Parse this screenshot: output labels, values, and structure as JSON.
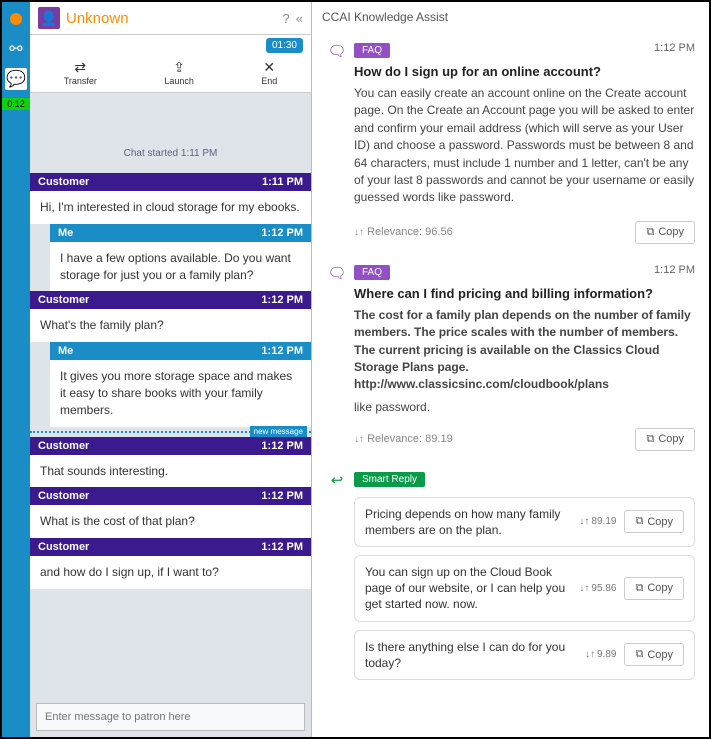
{
  "sidebar": {
    "badge": "0:12"
  },
  "header": {
    "name": "Unknown",
    "timer": "01:30"
  },
  "actions": {
    "transfer": "Transfer",
    "launch": "Launch",
    "end": "End"
  },
  "chat": {
    "started": "Chat started 1:11 PM",
    "labels": {
      "customer": "Customer",
      "me": "Me",
      "newmsg": "new message",
      "placeholder": "Enter message to patron here"
    },
    "m": [
      {
        "who": "customer",
        "time": "1:11 PM",
        "text": "Hi, I'm interested in cloud storage for my ebooks."
      },
      {
        "who": "me",
        "time": "1:12 PM",
        "text": "I have a few  options available. Do you want storage for just you or a family plan?"
      },
      {
        "who": "customer",
        "time": "1:12 PM",
        "text": "What's the family plan?"
      },
      {
        "who": "me",
        "time": "1:12 PM",
        "text": "It gives you more storage space and makes it easy to share books with your family members."
      },
      {
        "who": "customer",
        "time": "1:12 PM",
        "text": "That sounds interesting."
      },
      {
        "who": "customer",
        "time": "1:12 PM",
        "text": "What is the cost of that plan?"
      },
      {
        "who": "customer",
        "time": "1:12 PM",
        "text": "and how do I sign up, if I want to?"
      }
    ]
  },
  "assist": {
    "title": "CCAI Knowledge Assist",
    "faqLabel": "FAQ",
    "srLabel": "Smart Reply",
    "copyLabel": "Copy",
    "relLabel": "Relevance:",
    "faqs": [
      {
        "time": "1:12 PM",
        "q": "How do I sign up for an online account?",
        "a": "You can easily create an account online on the Create account page. On the Create an Account page you will be asked to enter and confirm your email address (which will serve as your User ID) and choose a password. Passwords must be between 8 and 64 characters, must include 1 number and 1 letter, can't be any of your last 8 passwords and cannot be your username or easily guessed words like password.",
        "rel": "96.56"
      },
      {
        "time": "1:12 PM",
        "q": "Where can I find pricing and billing information?",
        "a": "The cost for a family plan depends on the number of family members. The price scales with the number of members. The current pricing is available on the Classics Cloud Storage Plans page. http://www.classicsinc.com/cloudbook/plans",
        "extra": "like password.",
        "rel": "89.19"
      }
    ],
    "replies": [
      {
        "text": "Pricing depends on how many family members are on the plan.",
        "score": "89.19"
      },
      {
        "text": "You can sign up on the Cloud Book page of our website, or I can help you get started now. now.",
        "score": "95.86"
      },
      {
        "text": "Is there anything else I can do for you today?",
        "score": "9.89"
      }
    ]
  }
}
